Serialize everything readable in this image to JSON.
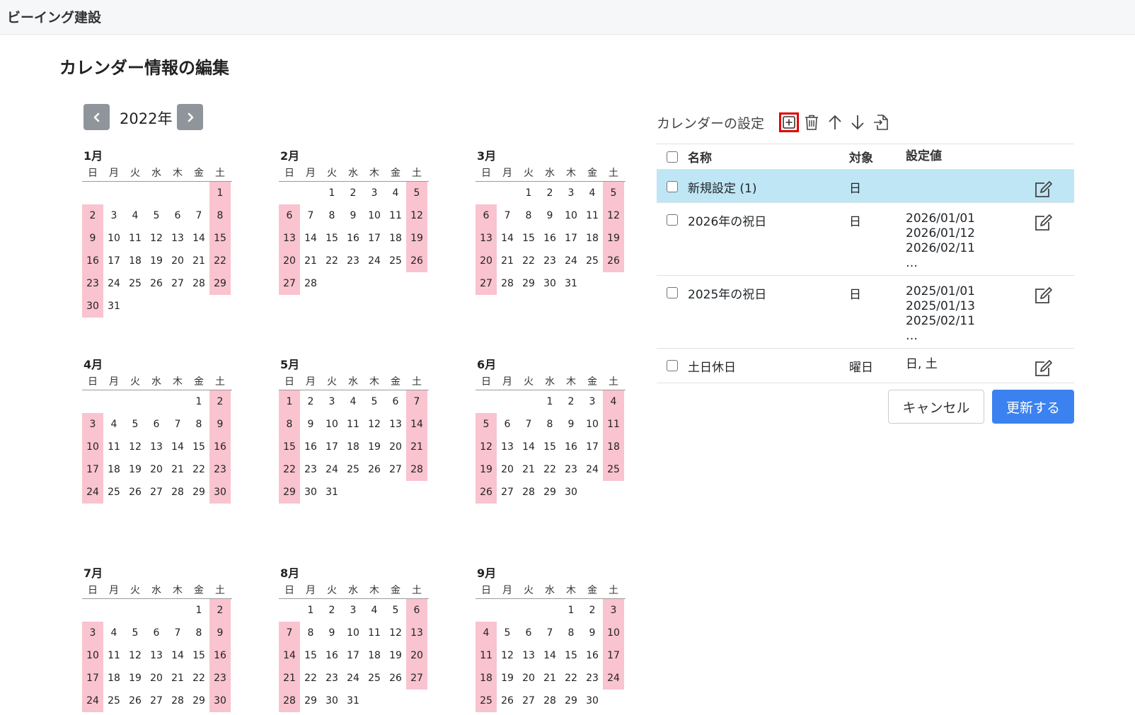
{
  "app": {
    "brand": "ビーイング建設"
  },
  "page": {
    "title": "カレンダー情報の編集"
  },
  "year_nav": {
    "year_label": "2022年",
    "prev_icon": "chevron-left-icon",
    "next_icon": "chevron-right-icon"
  },
  "calendar": {
    "weekdays": [
      "日",
      "月",
      "火",
      "水",
      "木",
      "金",
      "土"
    ],
    "holiday_color": "#f9c3cf",
    "months": [
      {
        "title": "1月",
        "weeks": [
          [
            "",
            "",
            "",
            "",
            "",
            "",
            "1"
          ],
          [
            "2",
            "3",
            "4",
            "5",
            "6",
            "7",
            "8"
          ],
          [
            "9",
            "10",
            "11",
            "12",
            "13",
            "14",
            "15"
          ],
          [
            "16",
            "17",
            "18",
            "19",
            "20",
            "21",
            "22"
          ],
          [
            "23",
            "24",
            "25",
            "26",
            "27",
            "28",
            "29"
          ],
          [
            "30",
            "31",
            "",
            "",
            "",
            "",
            ""
          ]
        ]
      },
      {
        "title": "2月",
        "weeks": [
          [
            "",
            "",
            "1",
            "2",
            "3",
            "4",
            "5"
          ],
          [
            "6",
            "7",
            "8",
            "9",
            "10",
            "11",
            "12"
          ],
          [
            "13",
            "14",
            "15",
            "16",
            "17",
            "18",
            "19"
          ],
          [
            "20",
            "21",
            "22",
            "23",
            "24",
            "25",
            "26"
          ],
          [
            "27",
            "28",
            "",
            "",
            "",
            "",
            ""
          ]
        ]
      },
      {
        "title": "3月",
        "weeks": [
          [
            "",
            "",
            "1",
            "2",
            "3",
            "4",
            "5"
          ],
          [
            "6",
            "7",
            "8",
            "9",
            "10",
            "11",
            "12"
          ],
          [
            "13",
            "14",
            "15",
            "16",
            "17",
            "18",
            "19"
          ],
          [
            "20",
            "21",
            "22",
            "23",
            "24",
            "25",
            "26"
          ],
          [
            "27",
            "28",
            "29",
            "30",
            "31",
            "",
            ""
          ]
        ]
      },
      {
        "title": "4月",
        "weeks": [
          [
            "",
            "",
            "",
            "",
            "",
            "1",
            "2"
          ],
          [
            "3",
            "4",
            "5",
            "6",
            "7",
            "8",
            "9"
          ],
          [
            "10",
            "11",
            "12",
            "13",
            "14",
            "15",
            "16"
          ],
          [
            "17",
            "18",
            "19",
            "20",
            "21",
            "22",
            "23"
          ],
          [
            "24",
            "25",
            "26",
            "27",
            "28",
            "29",
            "30"
          ]
        ]
      },
      {
        "title": "5月",
        "weeks": [
          [
            "1",
            "2",
            "3",
            "4",
            "5",
            "6",
            "7"
          ],
          [
            "8",
            "9",
            "10",
            "11",
            "12",
            "13",
            "14"
          ],
          [
            "15",
            "16",
            "17",
            "18",
            "19",
            "20",
            "21"
          ],
          [
            "22",
            "23",
            "24",
            "25",
            "26",
            "27",
            "28"
          ],
          [
            "29",
            "30",
            "31",
            "",
            "",
            "",
            ""
          ]
        ]
      },
      {
        "title": "6月",
        "weeks": [
          [
            "",
            "",
            "",
            "1",
            "2",
            "3",
            "4"
          ],
          [
            "5",
            "6",
            "7",
            "8",
            "9",
            "10",
            "11"
          ],
          [
            "12",
            "13",
            "14",
            "15",
            "16",
            "17",
            "18"
          ],
          [
            "19",
            "20",
            "21",
            "22",
            "23",
            "24",
            "25"
          ],
          [
            "26",
            "27",
            "28",
            "29",
            "30",
            "",
            ""
          ]
        ]
      },
      {
        "title": "7月",
        "weeks": [
          [
            "",
            "",
            "",
            "",
            "",
            "1",
            "2"
          ],
          [
            "3",
            "4",
            "5",
            "6",
            "7",
            "8",
            "9"
          ],
          [
            "10",
            "11",
            "12",
            "13",
            "14",
            "15",
            "16"
          ],
          [
            "17",
            "18",
            "19",
            "20",
            "21",
            "22",
            "23"
          ],
          [
            "24",
            "25",
            "26",
            "27",
            "28",
            "29",
            "30"
          ]
        ]
      },
      {
        "title": "8月",
        "weeks": [
          [
            "",
            "1",
            "2",
            "3",
            "4",
            "5",
            "6"
          ],
          [
            "7",
            "8",
            "9",
            "10",
            "11",
            "12",
            "13"
          ],
          [
            "14",
            "15",
            "16",
            "17",
            "18",
            "19",
            "20"
          ],
          [
            "21",
            "22",
            "23",
            "24",
            "25",
            "26",
            "27"
          ],
          [
            "28",
            "29",
            "30",
            "31",
            "",
            "",
            ""
          ]
        ]
      },
      {
        "title": "9月",
        "weeks": [
          [
            "",
            "",
            "",
            "",
            "1",
            "2",
            "3"
          ],
          [
            "4",
            "5",
            "6",
            "7",
            "8",
            "9",
            "10"
          ],
          [
            "11",
            "12",
            "13",
            "14",
            "15",
            "16",
            "17"
          ],
          [
            "18",
            "19",
            "20",
            "21",
            "22",
            "23",
            "24"
          ],
          [
            "25",
            "26",
            "27",
            "28",
            "29",
            "30",
            ""
          ]
        ]
      }
    ]
  },
  "settings": {
    "title": "カレンダーの設定",
    "toolbar_icons": [
      "plus-square-icon",
      "trash-icon",
      "arrow-up-icon",
      "arrow-down-icon",
      "file-import-icon"
    ],
    "columns": {
      "name": "名称",
      "target": "対象",
      "value": "設定値"
    },
    "rows": [
      {
        "name": "新規設定 (1)",
        "target": "日",
        "values": [],
        "selected": true
      },
      {
        "name": "2026年の祝日",
        "target": "日",
        "values": [
          "2026/01/01",
          "2026/01/12",
          "2026/02/11",
          "…"
        ],
        "selected": false
      },
      {
        "name": "2025年の祝日",
        "target": "日",
        "values": [
          "2025/01/01",
          "2025/01/13",
          "2025/02/11",
          "…"
        ],
        "selected": false
      },
      {
        "name": "土日休日",
        "target": "曜日",
        "values": [
          "日, 土"
        ],
        "selected": false
      }
    ],
    "selected_row_color": "#bfe6f5"
  },
  "actions": {
    "cancel": "キャンセル",
    "update": "更新する",
    "update_color": "#3b82f0"
  }
}
